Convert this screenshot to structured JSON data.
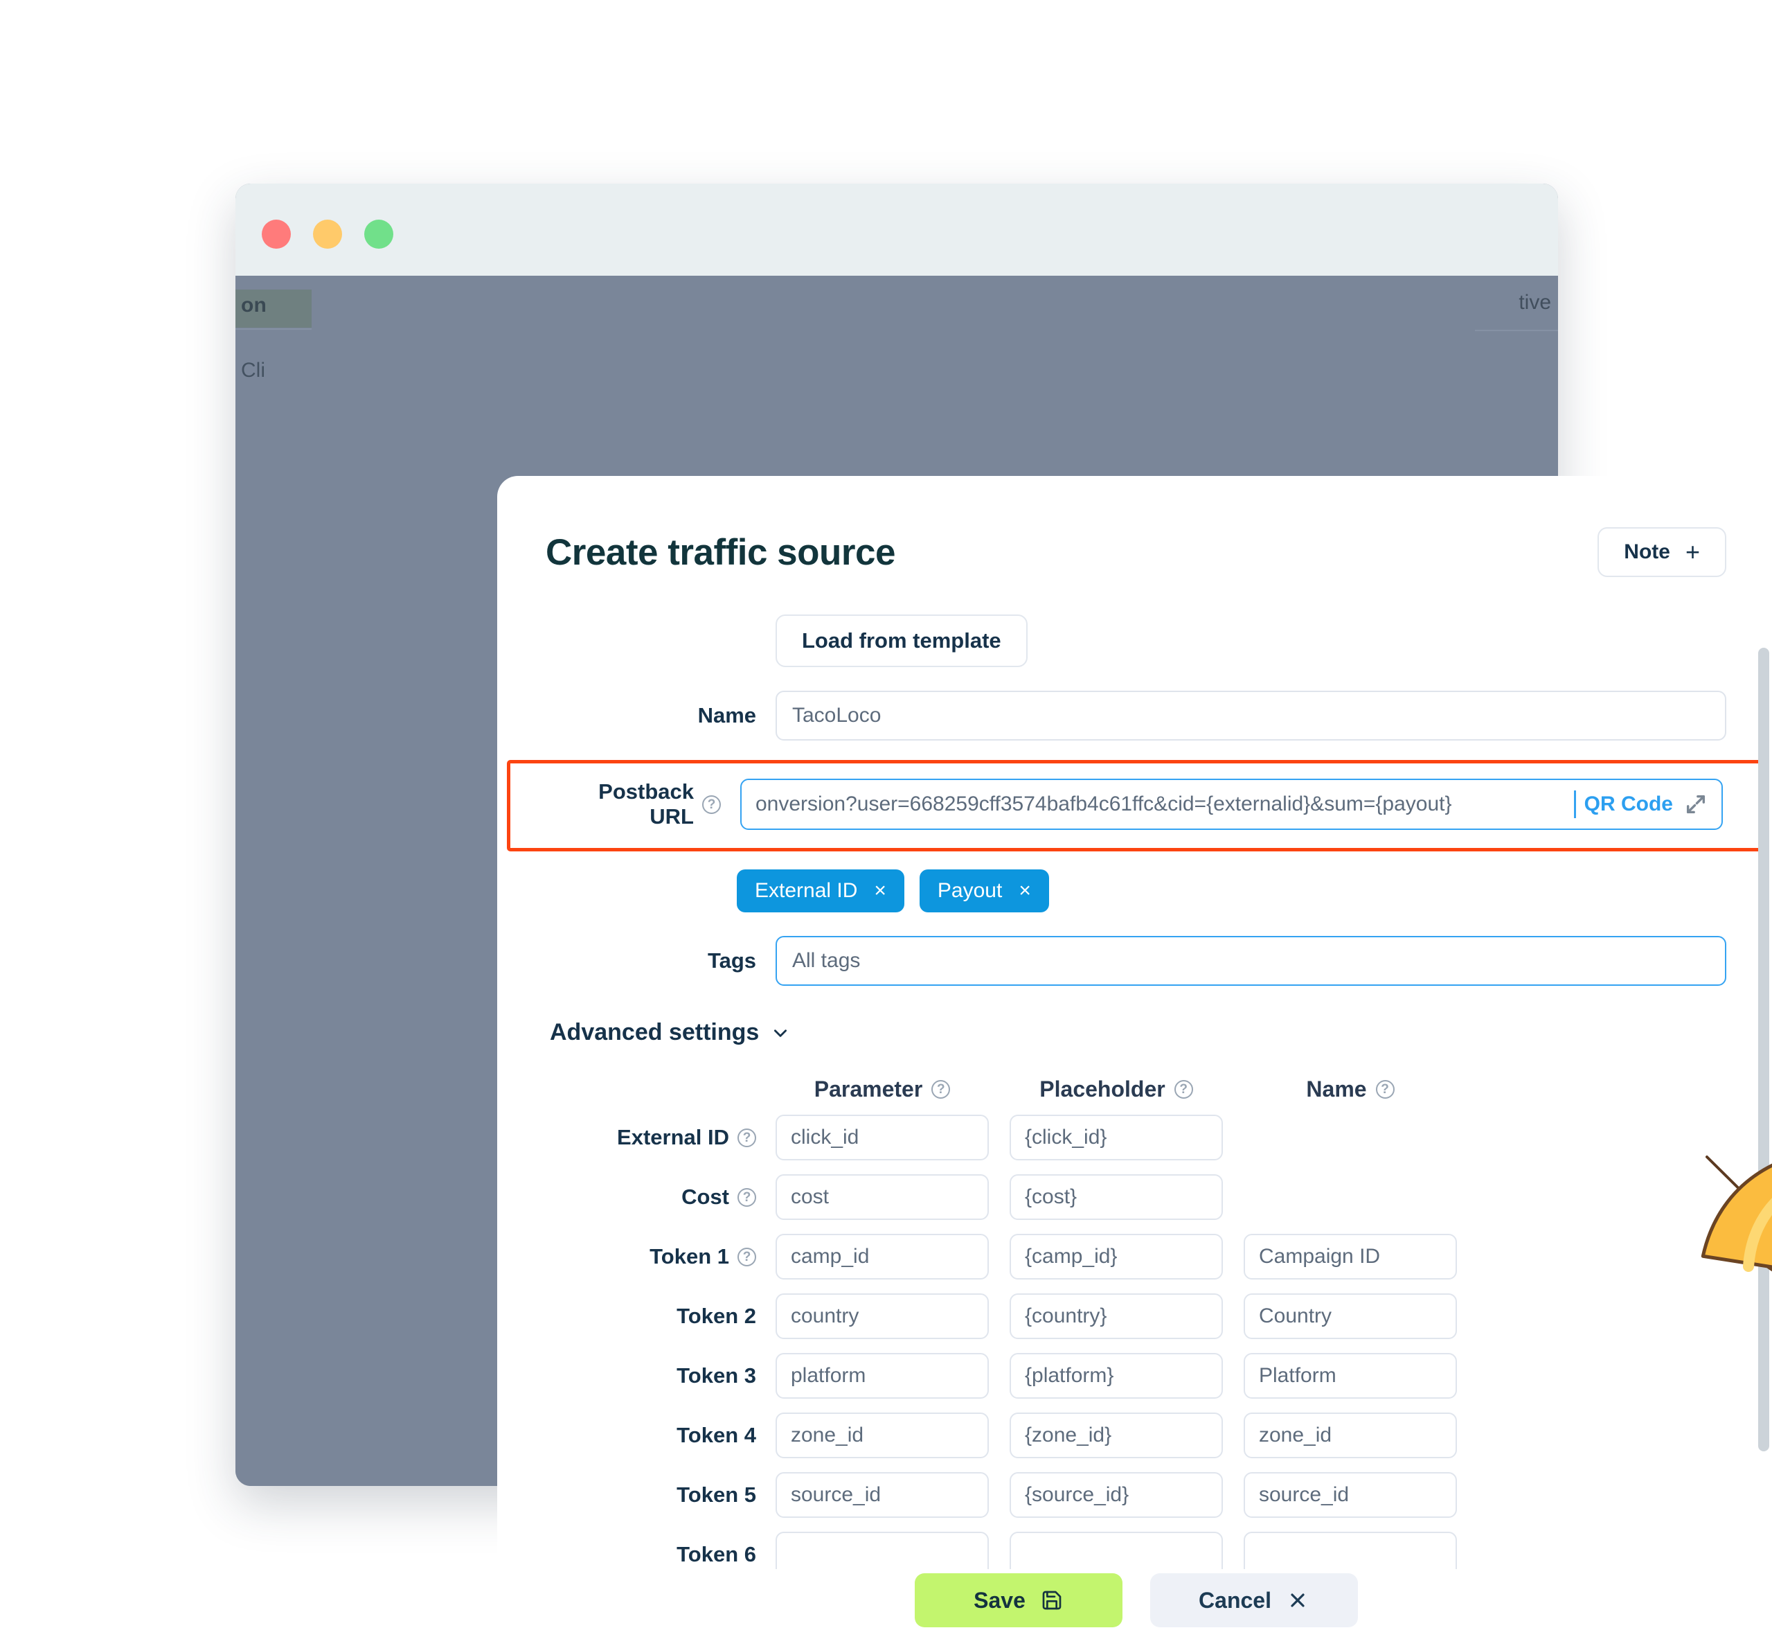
{
  "window": {
    "traffic_lights": [
      "close",
      "minimize",
      "maximize"
    ],
    "background_fragments": {
      "left_top": "on",
      "left_bottom": "Cli",
      "right_top": "tive"
    }
  },
  "modal": {
    "title": "Create traffic source",
    "note_button": {
      "label": "Note",
      "plus": "+"
    },
    "load_template_button": "Load from template",
    "name": {
      "label": "Name",
      "value": "TacoLoco"
    },
    "postback": {
      "label": "Postback URL",
      "value": "onversion?user=668259cff3574bafb4c61ffc&cid={externalid}&sum={payout}",
      "qr_label": "QR Code",
      "help": "?"
    },
    "chips": [
      {
        "label": "External ID",
        "close": "×"
      },
      {
        "label": "Payout",
        "close": "×"
      }
    ],
    "tags": {
      "label": "Tags",
      "placeholder": "All tags"
    },
    "advanced_settings": {
      "label": "Advanced settings",
      "chevron": "chevron-down"
    },
    "table": {
      "headers": [
        "",
        "Parameter",
        "Placeholder",
        "Name"
      ],
      "rows": [
        {
          "key": "External ID",
          "has_help": true,
          "parameter": "click_id",
          "placeholder": "{click_id}",
          "name": ""
        },
        {
          "key": "Cost",
          "has_help": true,
          "parameter": "cost",
          "placeholder": "{cost}",
          "name": ""
        },
        {
          "key": "Token 1",
          "has_help": true,
          "parameter": "camp_id",
          "placeholder": "{camp_id}",
          "name": "Campaign ID"
        },
        {
          "key": "Token 2",
          "has_help": false,
          "parameter": "country",
          "placeholder": "{country}",
          "name": "Country"
        },
        {
          "key": "Token 3",
          "has_help": false,
          "parameter": "platform",
          "placeholder": "{platform}",
          "name": "Platform"
        },
        {
          "key": "Token 4",
          "has_help": false,
          "parameter": "zone_id",
          "placeholder": "{zone_id}",
          "name": "zone_id"
        },
        {
          "key": "Token 5",
          "has_help": false,
          "parameter": "source_id",
          "placeholder": "{source_id}",
          "name": "source_id"
        },
        {
          "key": "Token 6",
          "has_help": false,
          "parameter": "",
          "placeholder": "",
          "name": ""
        }
      ]
    },
    "footer": {
      "save_label": "Save",
      "save_icon": "floppy-disk-icon",
      "cancel_label": "Cancel",
      "cancel_icon": "close-icon"
    }
  },
  "colors": {
    "accent_blue": "#35a3f2",
    "chip_blue": "#0d96de",
    "highlight_red": "#fc4411",
    "save_green": "#c3f56e",
    "title_dark": "#12353c",
    "window_chrome": "#7a8699"
  },
  "mascot": {
    "name": "taco-mascot",
    "description": "smiling taco character holding a pointer"
  }
}
